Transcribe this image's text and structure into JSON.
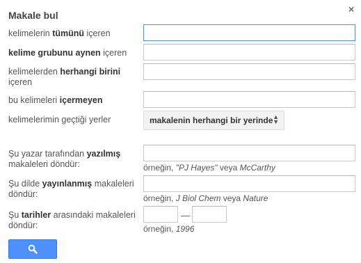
{
  "dialog": {
    "title": "Makale bul",
    "close_label": "×"
  },
  "fields": {
    "all_words": {
      "pre": "kelimelerin ",
      "bold": "tümünü",
      "post": " içeren",
      "value": ""
    },
    "exact_phrase": {
      "pre": "",
      "bold": "kelime grubunu aynen",
      "post": " içeren",
      "value": ""
    },
    "any_words": {
      "pre": "kelimelerden ",
      "bold": "herhangi birini",
      "post": " içeren",
      "value": ""
    },
    "without_words": {
      "pre": "bu kelimeleri ",
      "bold": "içermeyen",
      "post": "",
      "value": ""
    },
    "occurrence": {
      "label": "kelimelerimin geçtiği yerler",
      "selected": "makalenin herhangi bir yerinde"
    },
    "author": {
      "pre": "Şu yazar tarafından ",
      "bold": "yazılmış",
      "post": " makaleleri döndür:",
      "value": "",
      "hint_pre": "örneğin, ",
      "hint_ex1": "\"PJ Hayes\"",
      "hint_mid": " veya ",
      "hint_ex2": "McCarthy"
    },
    "publication": {
      "pre": "Şu dilde ",
      "bold": "yayınlanmış",
      "post": " makaleleri döndür:",
      "value": "",
      "hint_pre": "örneğin, ",
      "hint_ex1": "J Biol Chem",
      "hint_mid": " veya ",
      "hint_ex2": "Nature"
    },
    "dates": {
      "pre": "Şu ",
      "bold": "tarihler",
      "post": " arasındaki makaleleri döndür:",
      "from": "",
      "to": "",
      "separator": "—",
      "hint_pre": "örneğin, ",
      "hint_ex1": "1996"
    }
  },
  "search_button": {
    "icon": "search-icon"
  },
  "colors": {
    "accent": "#4d90fe",
    "focus_border": "#4d90fe"
  }
}
